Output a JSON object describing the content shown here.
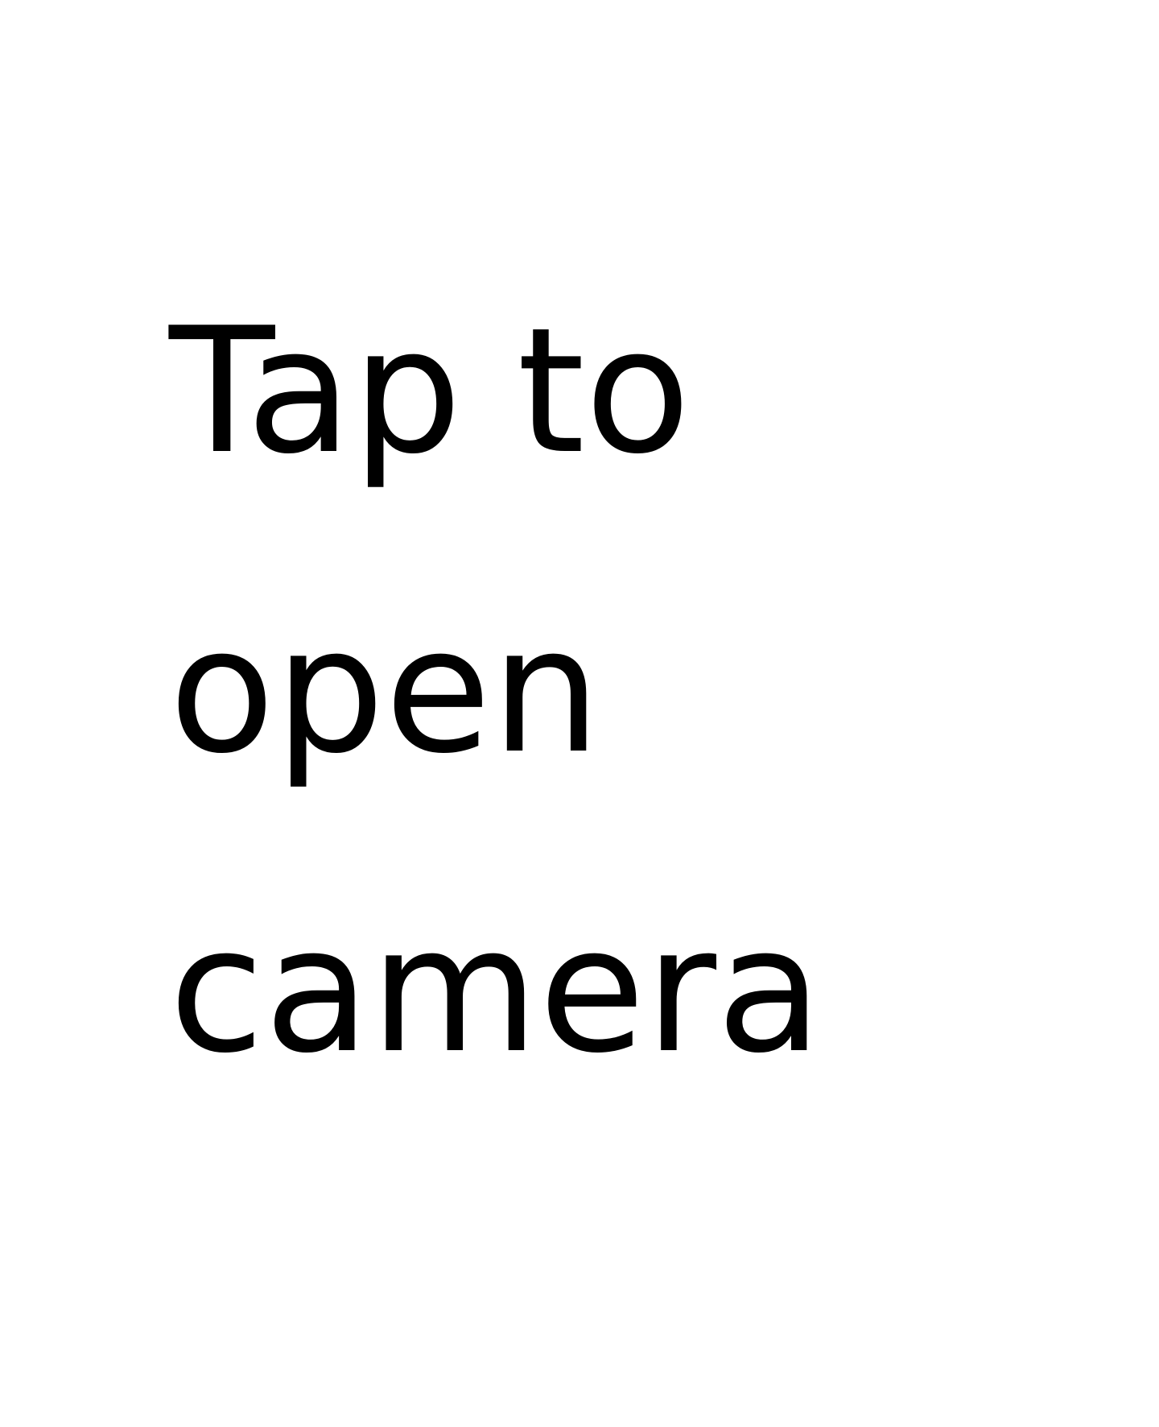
{
  "prompt": {
    "lines": [
      "Tap to",
      "open",
      "camera"
    ]
  },
  "colors": {
    "background": "#ffffff",
    "text": "#000000"
  }
}
